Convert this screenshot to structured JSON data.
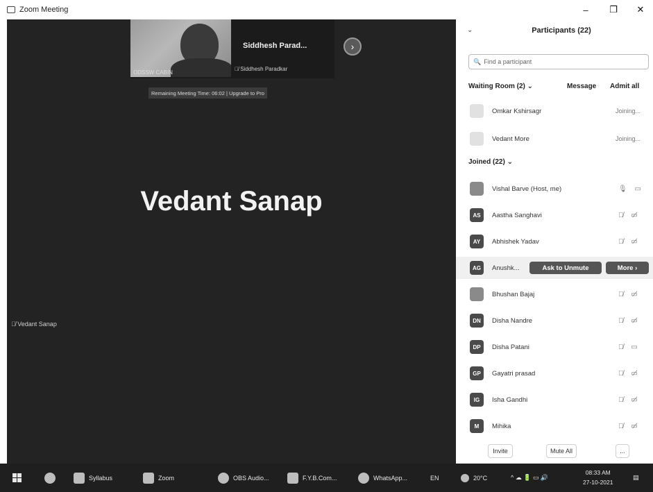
{
  "window": {
    "title": "Zoom Meeting",
    "minimize": "–",
    "maximize": "❐",
    "close": "✕"
  },
  "video": {
    "thumbnail": {
      "name": "Siddhesh Parad...",
      "muted_label": "Siddhesh Paradkar",
      "camera_label": "ODSSW CABIN"
    },
    "remaining_banner": "Remaining Meeting Time: 06:02 | Upgrade to Pro",
    "active_speaker": "Vedant Sanap",
    "speaker_label": "Vedant Sanap"
  },
  "participants": {
    "title": "Participants (22)",
    "search_placeholder": "Find a participant",
    "waiting_room": {
      "title": "Waiting Room (2)",
      "message": "Message",
      "admit_all": "Admit all",
      "people": [
        {
          "name": "Omkar Kshirsagr",
          "status": "Joining..."
        },
        {
          "name": "Vedant More",
          "status": "Joining..."
        }
      ]
    },
    "joined_title": "Joined (22)",
    "joined": [
      {
        "initials": "",
        "name": "Vishal Barve (Host, me)",
        "icons": "🎙 ▭"
      },
      {
        "initials": "AS",
        "name": "Aastha Sanghavi",
        "icons": "🎙̸ ▭̸"
      },
      {
        "initials": "AY",
        "name": "Abhishek Yadav",
        "icons": "🎙̸ ▭̸"
      },
      {
        "initials": "AG",
        "name": "Anushk...",
        "ask": "Ask to Unmute",
        "more": "More ›"
      },
      {
        "initials": "",
        "name": "Bhushan Bajaj",
        "icons": "🎙̸ ▭̸"
      },
      {
        "initials": "DN",
        "name": "Disha Nandre",
        "icons": "🎙̸ ▭̸"
      },
      {
        "initials": "DP",
        "name": "Disha Patani",
        "icons": "🎙̸ ▭"
      },
      {
        "initials": "GP",
        "name": "Gayatri prasad",
        "icons": "🎙̸ ▭̸"
      },
      {
        "initials": "IG",
        "name": "Isha Gandhi",
        "icons": "🎙̸ ▭̸"
      },
      {
        "initials": "M",
        "name": "Mihika",
        "icons": "🎙̸ ▭̸"
      }
    ],
    "footer": {
      "invite": "Invite",
      "mute_all": "Mute All",
      "more": "..."
    }
  },
  "taskbar": {
    "items": [
      {
        "label": "Syllabus"
      },
      {
        "label": "Zoom"
      },
      {
        "label": "OBS Audio..."
      },
      {
        "label": "F.Y.B.Com..."
      },
      {
        "label": "WhatsApp..."
      }
    ],
    "lang": "EN",
    "weather": "20°C",
    "time": "08:33 AM",
    "date": "27-10-2021"
  }
}
